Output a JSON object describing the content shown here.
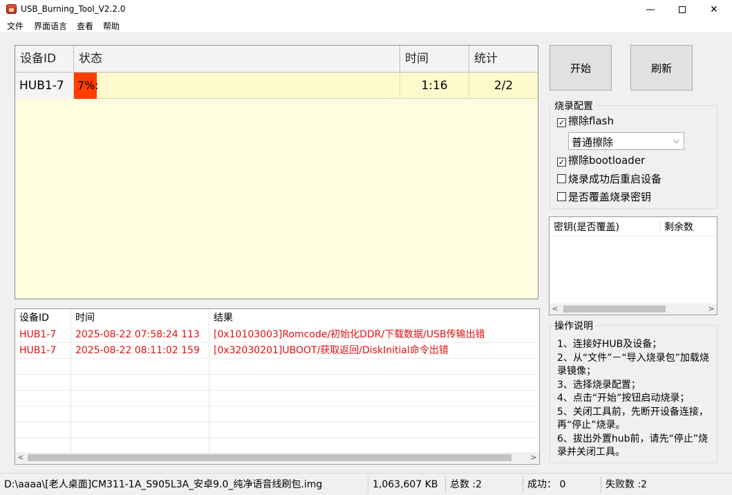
{
  "window": {
    "title": "USB_Burning_Tool_V2.2.0",
    "minimize": "—",
    "close": "✕"
  },
  "menu": [
    "文件",
    "界面语言",
    "查看",
    "帮助"
  ],
  "device_table": {
    "headers": [
      "设备ID",
      "状态",
      "时间",
      "统计"
    ],
    "rows": [
      {
        "id": "HUB1-7",
        "status": "7%:",
        "progress_percent": 7,
        "time": "1:16",
        "stat": "2/2"
      }
    ]
  },
  "buttons": {
    "start": "开始",
    "refresh": "刷新"
  },
  "burn_config": {
    "title": "烧录配置",
    "erase_flash": {
      "label": "擦除flash",
      "checked": true
    },
    "erase_mode": {
      "selected": "普通擦除"
    },
    "erase_bootloader": {
      "label": "擦除bootloader",
      "checked": true
    },
    "reboot_after": {
      "label": "烧录成功后重启设备",
      "checked": false
    },
    "overwrite_key": {
      "label": "是否覆盖烧录密钥",
      "checked": false
    }
  },
  "key_table": {
    "headers": [
      "密钥(是否覆盖)",
      "剩余数"
    ]
  },
  "log_table": {
    "headers": [
      "设备ID",
      "时间",
      "结果"
    ],
    "rows": [
      {
        "id": "HUB1-7",
        "time": "2025-08-22 07:58:24 113",
        "result": "[0x10103003]Romcode/初始化DDR/下载数据/USB传输出错"
      },
      {
        "id": "HUB1-7",
        "time": "2025-08-22 08:11:02 159",
        "result": "[0x32030201]UBOOT/获取返回/DiskInitial命令出错"
      }
    ]
  },
  "instructions": {
    "title": "操作说明",
    "lines": [
      "1、连接好HUB及设备；",
      "2、从“文件”－“导入烧录包”加载烧录镜像；",
      "3、选择烧录配置；",
      "4、点击“开始”按钮启动烧录；",
      "5、关闭工具前，先断开设备连接，再“停止”烧录。",
      "6、拔出外置hub前，请先“停止”烧录并关闭工具。"
    ]
  },
  "status_bar": {
    "path": "D:\\aaaa\\[老人桌面]CM311-1A_S905L3A_安卓9.0_纯净语音线刷包.img",
    "size": "1,063,607 KB",
    "total": "总数 :2",
    "success": "成功： 0",
    "fail": "失败数 :2"
  },
  "colors": {
    "progress": "#ff3e00",
    "error_text": "#e01010",
    "table_bg": "#fffde0"
  }
}
